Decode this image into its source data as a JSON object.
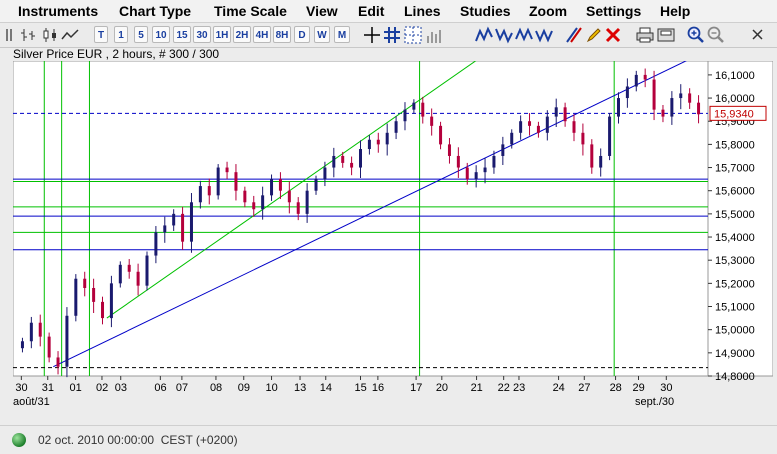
{
  "menu": [
    "Instruments",
    "Chart Type",
    "Time Scale",
    "View",
    "Edit",
    "Lines",
    "Studies",
    "Zoom",
    "Settings",
    "Help"
  ],
  "toolbar": {
    "timescale_buttons": [
      "T",
      "1",
      "5",
      "10",
      "15",
      "30",
      "1H",
      "2H",
      "4H",
      "8H",
      "D",
      "W",
      "M"
    ],
    "icons": [
      "grip-icon",
      "bars-icon",
      "candles-icon",
      "line-chart-icon",
      "crosshair-icon",
      "grid-icon",
      "dashed-grid-icon",
      "volume-icon",
      "trend-up-icon",
      "trend-down-icon",
      "trend-both-icon",
      "trend-flat-icon",
      "channel-icon",
      "pencil-icon",
      "eraser-icon",
      "delete-lines-icon",
      "print-icon",
      "save-icon",
      "zoom-in-icon",
      "zoom-out-icon",
      "cursor-icon"
    ]
  },
  "chart": {
    "title": "Silver Price EUR , 2 hours, # 300 / 300",
    "price_label": "15,9340",
    "y_ticks": [
      "16,1000",
      "16,0000",
      "15,9000",
      "15,8000",
      "15,7000",
      "15,6000",
      "15,5000",
      "15,4000",
      "15,3000",
      "15,2000",
      "15,1000",
      "15,0000",
      "14,9000",
      "14,8000"
    ],
    "x_ticks": [
      "30",
      "31",
      "01",
      "02",
      "03",
      "06",
      "07",
      "08",
      "09",
      "10",
      "13",
      "14",
      "15",
      "16",
      "17",
      "20",
      "21",
      "22",
      "23",
      "24",
      "27",
      "28",
      "29",
      "30"
    ],
    "x_month_labels": [
      "août/31",
      "sept./30"
    ],
    "colors": {
      "up": "#1a1a6e",
      "down": "#b4003c",
      "blue_line": "#0000c8",
      "green_line": "#00c000",
      "price_box": "#c00000"
    }
  },
  "chart_data": {
    "type": "candlestick",
    "title": "Silver Price EUR , 2 hours, # 300 / 300",
    "ylim": [
      14.8,
      16.16
    ],
    "last_price": 15.934,
    "closes": [
      14.95,
      15.03,
      14.97,
      14.88,
      14.84,
      15.06,
      15.22,
      15.18,
      15.12,
      15.05,
      15.2,
      15.28,
      15.25,
      15.19,
      15.32,
      15.42,
      15.45,
      15.5,
      15.38,
      15.55,
      15.62,
      15.58,
      15.7,
      15.68,
      15.6,
      15.55,
      15.52,
      15.58,
      15.65,
      15.6,
      15.55,
      15.5,
      15.6,
      15.65,
      15.7,
      15.75,
      15.72,
      15.7,
      15.78,
      15.82,
      15.8,
      15.85,
      15.9,
      15.95,
      15.98,
      15.92,
      15.88,
      15.8,
      15.75,
      15.7,
      15.65,
      15.68,
      15.7,
      15.75,
      15.8,
      15.85,
      15.9,
      15.88,
      15.85,
      15.92,
      15.96,
      15.9,
      15.85,
      15.8,
      15.7,
      15.75,
      15.92,
      16.0,
      16.05,
      16.1,
      16.08,
      15.95,
      15.92,
      16.0,
      16.02,
      15.98,
      15.93
    ],
    "horizontal_lines": [
      {
        "y": 15.934,
        "style": "dashed",
        "color": "blue"
      },
      {
        "y": 15.65,
        "color": "blue"
      },
      {
        "y": 15.64,
        "color": "green"
      },
      {
        "y": 15.53,
        "color": "green"
      },
      {
        "y": 15.49,
        "color": "blue"
      },
      {
        "y": 15.42,
        "color": "green"
      },
      {
        "y": 15.345,
        "color": "blue"
      },
      {
        "y": 14.836,
        "style": "dashed",
        "color": "black"
      }
    ],
    "trendlines": [
      {
        "from": {
          "x": 0.058,
          "y": 14.84
        },
        "to": {
          "x": 0.975,
          "y": 16.17
        },
        "color": "blue"
      },
      {
        "from": {
          "x": 0.135,
          "y": 15.05
        },
        "to": {
          "x": 0.675,
          "y": 16.18
        },
        "color": "green"
      }
    ],
    "vertical_lines": [
      0.045,
      0.07,
      0.11,
      0.585,
      0.865
    ]
  }
}
